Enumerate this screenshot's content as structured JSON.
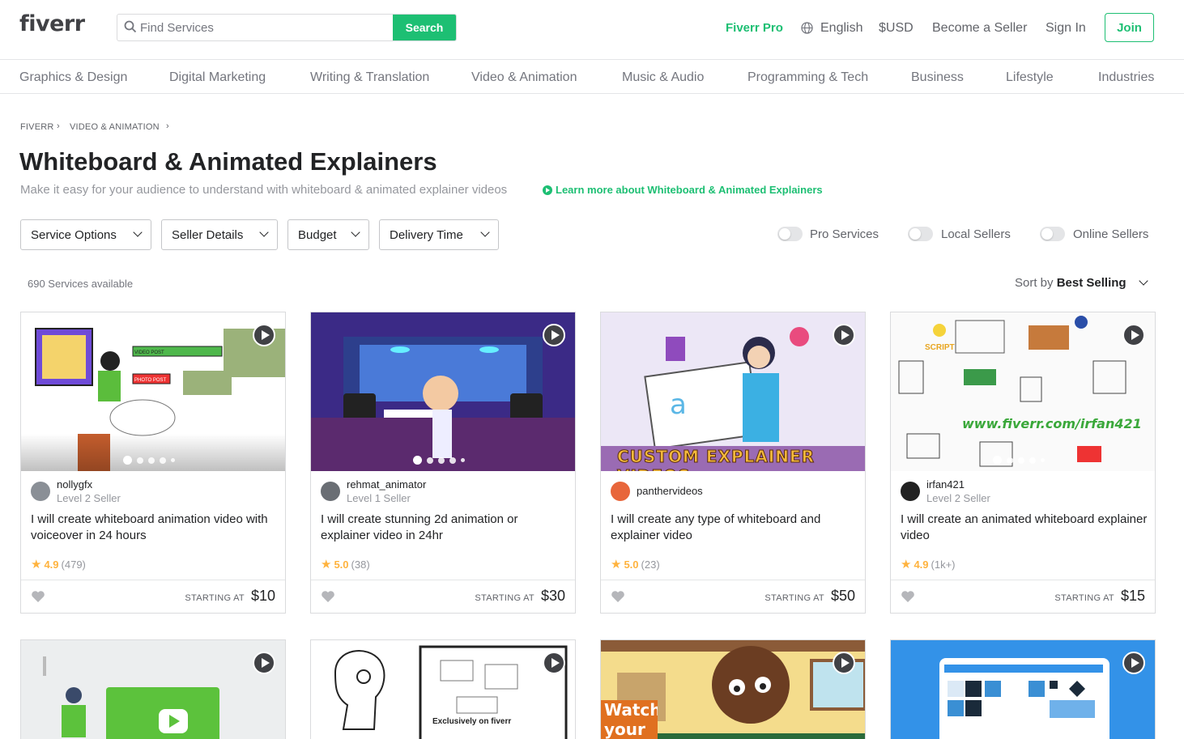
{
  "header": {
    "logo": "fiverr",
    "search_placeholder": "Find Services",
    "search_button": "Search",
    "fiverr_pro": "Fiverr Pro",
    "language": "English",
    "currency": "$USD",
    "become_seller": "Become a Seller",
    "sign_in": "Sign In",
    "join": "Join"
  },
  "categories": [
    "Graphics & Design",
    "Digital Marketing",
    "Writing & Translation",
    "Video & Animation",
    "Music & Audio",
    "Programming & Tech",
    "Business",
    "Lifestyle",
    "Industries"
  ],
  "breadcrumb": [
    "FIVERR",
    "VIDEO & ANIMATION"
  ],
  "page": {
    "title": "Whiteboard & Animated Explainers",
    "subtitle": "Make it easy for your audience to understand with whiteboard & animated explainer videos",
    "learn_more": "Learn more about Whiteboard & Animated Explainers"
  },
  "filters": [
    "Service Options",
    "Seller Details",
    "Budget",
    "Delivery Time"
  ],
  "toggles": [
    "Pro Services",
    "Local Sellers",
    "Online Sellers"
  ],
  "results": {
    "count": "690 Services available",
    "sort_label": "Sort by",
    "sort_value": "Best Selling"
  },
  "gigs": [
    {
      "seller": "nollygfx",
      "level": "Level 2 Seller",
      "title": "I will create whiteboard animation video with voiceover in 24 hours",
      "rating": "4.9",
      "reviews": "(479)",
      "starting": "STARTING AT",
      "price": "$10"
    },
    {
      "seller": "rehmat_animator",
      "level": "Level 1 Seller",
      "title": "I will create stunning 2d animation or explainer video in 24hr",
      "rating": "5.0",
      "reviews": "(38)",
      "starting": "STARTING AT",
      "price": "$30"
    },
    {
      "seller": "panthervideos",
      "level": "",
      "title": "I will create any type of whiteboard and explainer video",
      "rating": "5.0",
      "reviews": "(23)",
      "starting": "STARTING AT",
      "price": "$50",
      "thumb_text": "CUSTOM EXPLAINER VIDEOS"
    },
    {
      "seller": "irfan421",
      "level": "Level 2 Seller",
      "title": "I will create an animated whiteboard explainer video",
      "rating": "4.9",
      "reviews": "(1k+)",
      "starting": "STARTING AT",
      "price": "$15",
      "thumb_text": "www.fiverr.com/irfan421"
    }
  ],
  "second_row_thumbs": {
    "card7_text": "Watch your sales",
    "card6_text": "Exclusively on fiverr"
  },
  "colors": {
    "brand": "#1dbf73",
    "star": "#ffb33e",
    "text": "#404145"
  }
}
